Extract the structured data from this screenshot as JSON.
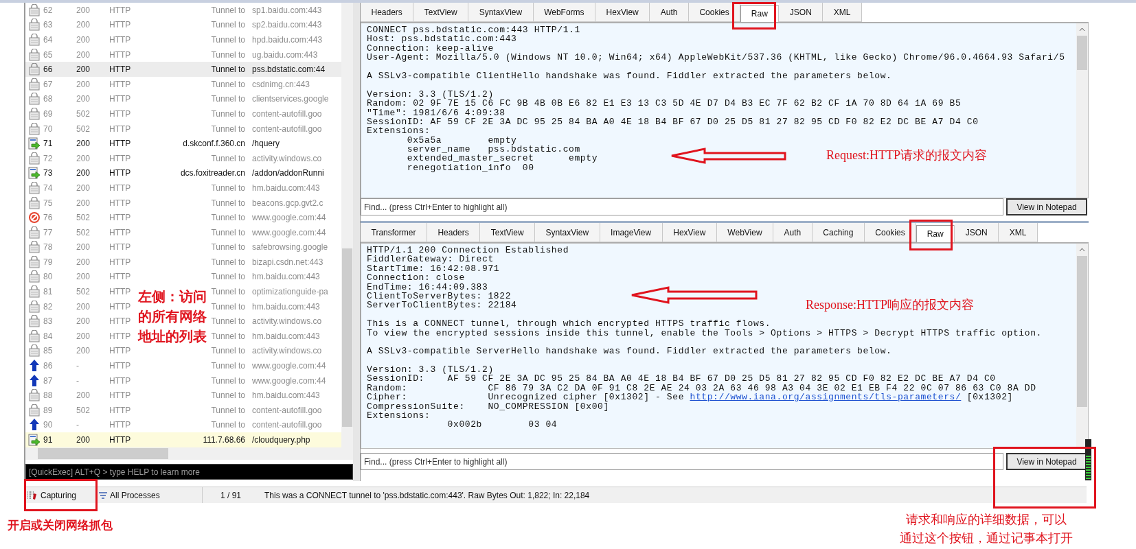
{
  "session_list": {
    "rows": [
      {
        "kind": "lock",
        "number": "62",
        "result": "200",
        "protocol": "HTTP",
        "host": "Tunnel to",
        "url": "sp1.baidu.com:443",
        "selected": false,
        "highlighted": false
      },
      {
        "kind": "lock",
        "number": "63",
        "result": "200",
        "protocol": "HTTP",
        "host": "Tunnel to",
        "url": "sp2.baidu.com:443",
        "selected": false,
        "highlighted": false
      },
      {
        "kind": "lock",
        "number": "64",
        "result": "200",
        "protocol": "HTTP",
        "host": "Tunnel to",
        "url": "hpd.baidu.com:443",
        "selected": false,
        "highlighted": false
      },
      {
        "kind": "lock",
        "number": "65",
        "result": "200",
        "protocol": "HTTP",
        "host": "Tunnel to",
        "url": "ug.baidu.com:443",
        "selected": false,
        "highlighted": false
      },
      {
        "kind": "lock",
        "number": "66",
        "result": "200",
        "protocol": "HTTP",
        "host": "Tunnel to",
        "url": "pss.bdstatic.com:44",
        "selected": true,
        "highlighted": false
      },
      {
        "kind": "lock",
        "number": "67",
        "result": "200",
        "protocol": "HTTP",
        "host": "Tunnel to",
        "url": "csdnimg.cn:443",
        "selected": false,
        "highlighted": false
      },
      {
        "kind": "lock",
        "number": "68",
        "result": "200",
        "protocol": "HTTP",
        "host": "Tunnel to",
        "url": "clientservices.google",
        "selected": false,
        "highlighted": false
      },
      {
        "kind": "lock",
        "number": "69",
        "result": "502",
        "protocol": "HTTP",
        "host": "Tunnel to",
        "url": "content-autofill.goo",
        "selected": false,
        "highlighted": false
      },
      {
        "kind": "lock",
        "number": "70",
        "result": "502",
        "protocol": "HTTP",
        "host": "Tunnel to",
        "url": "content-autofill.goo",
        "selected": false,
        "highlighted": false
      },
      {
        "kind": "script",
        "number": "71",
        "result": "200",
        "protocol": "HTTP",
        "host": "d.skconf.f.360.cn",
        "url": "/hquery",
        "selected": false,
        "highlighted": false
      },
      {
        "kind": "lock",
        "number": "72",
        "result": "200",
        "protocol": "HTTP",
        "host": "Tunnel to",
        "url": "activity.windows.co",
        "selected": false,
        "highlighted": false
      },
      {
        "kind": "script",
        "number": "73",
        "result": "200",
        "protocol": "HTTP",
        "host": "dcs.foxitreader.cn",
        "url": "/addon/addonRunni",
        "selected": false,
        "highlighted": false
      },
      {
        "kind": "lock",
        "number": "74",
        "result": "200",
        "protocol": "HTTP",
        "host": "Tunnel to",
        "url": "hm.baidu.com:443",
        "selected": false,
        "highlighted": false
      },
      {
        "kind": "lock",
        "number": "75",
        "result": "200",
        "protocol": "HTTP",
        "host": "Tunnel to",
        "url": "beacons.gcp.gvt2.c",
        "selected": false,
        "highlighted": false
      },
      {
        "kind": "blocked",
        "number": "76",
        "result": "502",
        "protocol": "HTTP",
        "host": "Tunnel to",
        "url": "www.google.com:44",
        "selected": false,
        "highlighted": false
      },
      {
        "kind": "lock",
        "number": "77",
        "result": "502",
        "protocol": "HTTP",
        "host": "Tunnel to",
        "url": "www.google.com:44",
        "selected": false,
        "highlighted": false
      },
      {
        "kind": "lock",
        "number": "78",
        "result": "200",
        "protocol": "HTTP",
        "host": "Tunnel to",
        "url": "safebrowsing.google",
        "selected": false,
        "highlighted": false
      },
      {
        "kind": "lock",
        "number": "79",
        "result": "200",
        "protocol": "HTTP",
        "host": "Tunnel to",
        "url": "bizapi.csdn.net:443",
        "selected": false,
        "highlighted": false
      },
      {
        "kind": "lock",
        "number": "80",
        "result": "200",
        "protocol": "HTTP",
        "host": "Tunnel to",
        "url": "hm.baidu.com:443",
        "selected": false,
        "highlighted": false
      },
      {
        "kind": "lock",
        "number": "81",
        "result": "502",
        "protocol": "HTTP",
        "host": "Tunnel to",
        "url": "optimizationguide-pa",
        "selected": false,
        "highlighted": false
      },
      {
        "kind": "lock",
        "number": "82",
        "result": "200",
        "protocol": "HTTP",
        "host": "Tunnel to",
        "url": "hm.baidu.com:443",
        "selected": false,
        "highlighted": false
      },
      {
        "kind": "lock",
        "number": "83",
        "result": "200",
        "protocol": "HTTP",
        "host": "Tunnel to",
        "url": "activity.windows.co",
        "selected": false,
        "highlighted": false
      },
      {
        "kind": "lock",
        "number": "84",
        "result": "200",
        "protocol": "HTTP",
        "host": "Tunnel to",
        "url": "hm.baidu.com:443",
        "selected": false,
        "highlighted": false
      },
      {
        "kind": "lock",
        "number": "85",
        "result": "200",
        "protocol": "HTTP",
        "host": "Tunnel to",
        "url": "activity.windows.co",
        "selected": false,
        "highlighted": false
      },
      {
        "kind": "upload",
        "number": "86",
        "result": "-",
        "protocol": "HTTP",
        "host": "Tunnel to",
        "url": "www.google.com:44",
        "selected": false,
        "highlighted": false
      },
      {
        "kind": "upload",
        "number": "87",
        "result": "-",
        "protocol": "HTTP",
        "host": "Tunnel to",
        "url": "www.google.com:44",
        "selected": false,
        "highlighted": false
      },
      {
        "kind": "lock",
        "number": "88",
        "result": "200",
        "protocol": "HTTP",
        "host": "Tunnel to",
        "url": "hm.baidu.com:443",
        "selected": false,
        "highlighted": false
      },
      {
        "kind": "lock",
        "number": "89",
        "result": "502",
        "protocol": "HTTP",
        "host": "Tunnel to",
        "url": "content-autofill.goo",
        "selected": false,
        "highlighted": false
      },
      {
        "kind": "upload",
        "number": "90",
        "result": "-",
        "protocol": "HTTP",
        "host": "Tunnel to",
        "url": "content-autofill.goo",
        "selected": false,
        "highlighted": false
      },
      {
        "kind": "script",
        "number": "91",
        "result": "200",
        "protocol": "HTTP",
        "host": "111.7.68.66",
        "url": "/cloudquery.php",
        "selected": false,
        "highlighted": true
      }
    ]
  },
  "quick_exec": {
    "placeholder": "[QuickExec] ALT+Q > type HELP to learn more"
  },
  "request": {
    "tabs": [
      {
        "label": "Headers",
        "selected": false
      },
      {
        "label": "TextView",
        "selected": false
      },
      {
        "label": "SyntaxView",
        "selected": false
      },
      {
        "label": "WebForms",
        "selected": false
      },
      {
        "label": "HexView",
        "selected": false
      },
      {
        "label": "Auth",
        "selected": false
      },
      {
        "label": "Cookies",
        "selected": false
      },
      {
        "label": "Raw",
        "selected": true
      },
      {
        "label": "JSON",
        "selected": false
      },
      {
        "label": "XML",
        "selected": false
      }
    ],
    "blocks": [
      [
        "CONNECT pss.bdstatic.com:443 HTTP/1.1",
        "Host: pss.bdstatic.com:443",
        "Connection: keep-alive",
        "User-Agent: Mozilla/5.0 (Windows NT 10.0; Win64; x64) AppleWebKit/537.36 (KHTML, like Gecko) Chrome/96.0.4664.93 Safari/5"
      ],
      [
        "A SSLv3-compatible ClientHello handshake was found. Fiddler extracted the parameters below."
      ],
      [
        "Version: 3.3 (TLS/1.2)",
        "Random: 02 9F 7E 15 C6 FC 9B 4B 0B E6 82 E1 E3 13 C3 5D 4E D7 D4 B3 EC 7F 62 B2 CF 1A 70 8D 64 1A 69 B5",
        "\"Time\": 1981/6/6 4:09:38",
        "SessionID: AF 59 CF 2E 3A DC 95 25 84 BA A0 4E 18 B4 BF 67 D0 25 D5 81 27 82 95 CD F0 82 E2 DC BE A7 D4 C0",
        "Extensions:",
        "       0x5a5a        empty",
        "       server_name   pss.bdstatic.com",
        "       extended_master_secret      empty",
        "       renegotiation_info  00"
      ]
    ],
    "find_placeholder": "Find... (press Ctrl+Enter to highlight all)",
    "button": "View in Notepad"
  },
  "response": {
    "tabs": [
      {
        "label": "Transformer",
        "selected": false
      },
      {
        "label": "Headers",
        "selected": false
      },
      {
        "label": "TextView",
        "selected": false
      },
      {
        "label": "SyntaxView",
        "selected": false
      },
      {
        "label": "ImageView",
        "selected": false
      },
      {
        "label": "HexView",
        "selected": false
      },
      {
        "label": "WebView",
        "selected": false
      },
      {
        "label": "Auth",
        "selected": false
      },
      {
        "label": "Caching",
        "selected": false
      },
      {
        "label": "Cookies",
        "selected": false
      },
      {
        "label": "Raw",
        "selected": true
      },
      {
        "label": "JSON",
        "selected": false
      },
      {
        "label": "XML",
        "selected": false
      }
    ],
    "blocks": [
      [
        "HTTP/1.1 200 Connection Established",
        "FiddlerGateway: Direct",
        "StartTime: 16:42:08.971",
        "Connection: close",
        "EndTime: 16:44:09.383",
        "ClientToServerBytes: 1822",
        "ServerToClientBytes: 22184"
      ],
      [
        "This is a CONNECT tunnel, through which encrypted HTTPS traffic flows.",
        "To view the encrypted sessions inside this tunnel, enable the Tools > Options > HTTPS > Decrypt HTTPS traffic option."
      ],
      [
        "A SSLv3-compatible ServerHello handshake was found. Fiddler extracted the parameters below."
      ],
      [
        "Version: 3.3 (TLS/1.2)",
        "SessionID:    AF 59 CF 2E 3A DC 95 25 84 BA A0 4E 18 B4 BF 67 D0 25 D5 81 27 82 95 CD F0 82 E2 DC BE A7 D4 C0",
        "Random:              CF 86 79 3A C2 DA 0F 91 C8 2E AE 24 03 2A 63 46 98 A3 04 3E 02 E1 EB F4 22 0C 07 86 63 C0 8A DD",
        {
          "before": "Cipher:              Unrecognized cipher [0x1302] - See ",
          "link": "http://www.iana.org/assignments/tls-parameters/",
          "after": " [0x1302]"
        },
        "CompressionSuite:    NO_COMPRESSION [0x00]",
        "Extensions:",
        "              0x002b        03 04"
      ]
    ],
    "find_placeholder": "Find... (press Ctrl+Enter to highlight all)",
    "button": "View in Notepad"
  },
  "status_bar": {
    "capturing": "Capturing",
    "processes": "All Processes",
    "count": "1 / 91",
    "message": "This was a CONNECT tunnel to 'pss.bdstatic.com:443'. Raw Bytes Out: 1,822; In: 22,184"
  },
  "annotations": {
    "request_note": "Request:HTTP请求的报文内容",
    "response_note": "Response:HTTP响应的报文内容",
    "list_note": [
      "左侧：访问",
      "的所有网络",
      "地址的列表"
    ],
    "capture_note": "开启或关闭网络抓包",
    "notepad_note": [
      "请求和响应的详细数据，可以",
      "通过这个按钮，通过记事本打开"
    ]
  }
}
